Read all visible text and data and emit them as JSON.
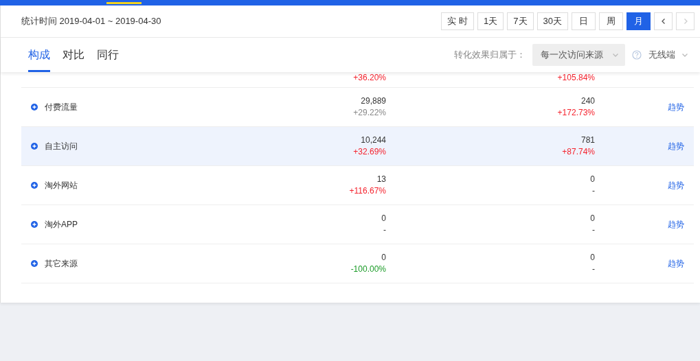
{
  "header": {
    "period_label": "统计时间 2019-04-01 ~ 2019-04-30",
    "ranges": [
      {
        "label": "实 时",
        "selected": false
      },
      {
        "label": "1天",
        "selected": false
      },
      {
        "label": "7天",
        "selected": false
      },
      {
        "label": "30天",
        "selected": false
      },
      {
        "label": "日",
        "selected": false
      },
      {
        "label": "周",
        "selected": false
      },
      {
        "label": "月",
        "selected": true
      }
    ],
    "prev_disabled": false,
    "next_disabled": true
  },
  "tabs": [
    {
      "label": "构成",
      "selected": true
    },
    {
      "label": "对比",
      "selected": false
    },
    {
      "label": "同行",
      "selected": false
    }
  ],
  "attribution": {
    "label": "转化效果归属于：",
    "value": "每一次访问来源",
    "device": "无线端"
  },
  "rows": [
    {
      "highlighted": false,
      "metrics": [
        {
          "change": "+36.20%",
          "color": "#f5222d"
        },
        {
          "change": "+105.84%",
          "color": "#f5222d"
        }
      ]
    },
    {
      "name": "付费流量",
      "highlighted": false,
      "metrics": [
        {
          "value": "29,889",
          "change": "+29.22%",
          "color": "#888888"
        },
        {
          "value": "240",
          "change": "+172.73%",
          "color": "#f5222d"
        }
      ],
      "link": "趋势"
    },
    {
      "name": "自主访问",
      "highlighted": true,
      "metrics": [
        {
          "value": "10,244",
          "change": "+32.69%",
          "color": "#f5222d"
        },
        {
          "value": "781",
          "change": "+87.74%",
          "color": "#f5222d"
        }
      ],
      "link": "趋势"
    },
    {
      "name": "淘外网站",
      "highlighted": false,
      "metrics": [
        {
          "value": "13",
          "change": "+116.67%",
          "color": "#f5222d"
        },
        {
          "value": "0",
          "change": "-"
        }
      ],
      "link": "趋势"
    },
    {
      "name": "淘外APP",
      "highlighted": false,
      "metrics": [
        {
          "value": "0",
          "change": "-"
        },
        {
          "value": "0",
          "change": "-"
        }
      ],
      "link": "趋势"
    },
    {
      "name": "其它来源",
      "highlighted": false,
      "metrics": [
        {
          "value": "0",
          "change": "-100.00%",
          "color": "#1a9b27"
        },
        {
          "value": "0",
          "change": "-"
        }
      ],
      "link": "趋势"
    }
  ]
}
